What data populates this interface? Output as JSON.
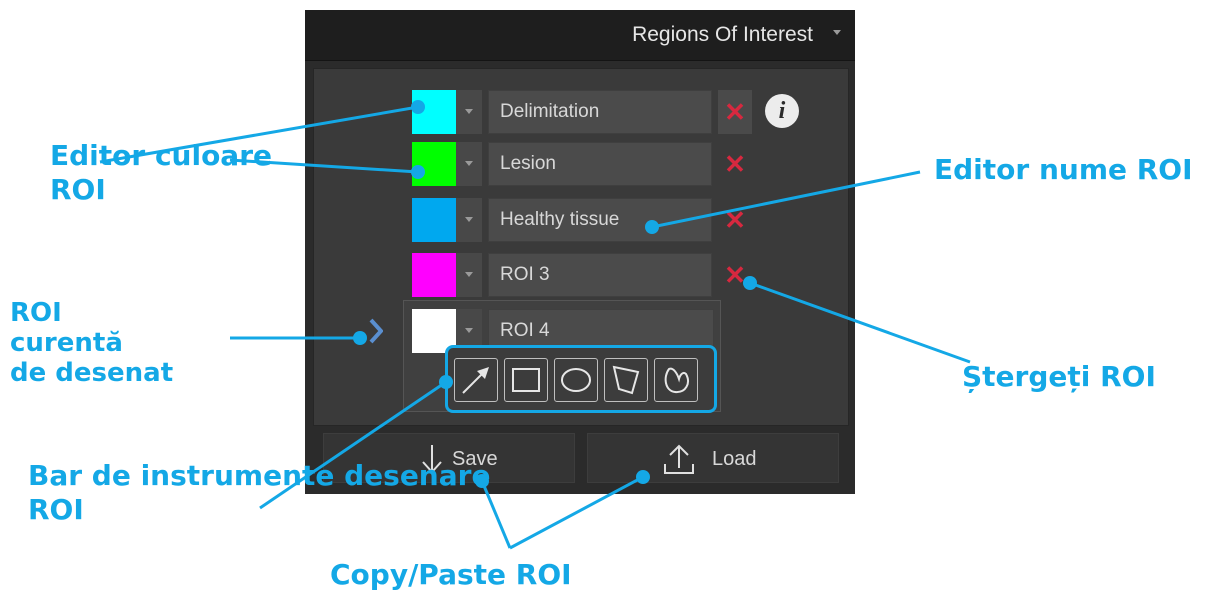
{
  "panel": {
    "title": "Regions Of Interest",
    "rois": [
      {
        "name": "Delimitation",
        "color": "#00ffff"
      },
      {
        "name": "Lesion",
        "color": "#00ff00"
      },
      {
        "name": "Healthy tissue",
        "color": "#00a8ef"
      },
      {
        "name": "ROI 3",
        "color": "#ff00ff"
      },
      {
        "name": "ROI 4",
        "color": "#ffffff"
      }
    ],
    "info_icon_glyph": "i",
    "delete_glyph": "✕",
    "tools": [
      "arrow-tool-icon",
      "rectangle-tool-icon",
      "ellipse-tool-icon",
      "polygon-tool-icon",
      "freehand-tool-icon"
    ],
    "save_label": "Save",
    "load_label": "Load"
  },
  "callouts": {
    "color_editor_line1": "Editor culoare",
    "color_editor_line2": "ROI",
    "name_editor": "Editor nume ROI",
    "current_line1": "ROI",
    "current_line2": "curentă",
    "current_line3": "de desenat",
    "delete_roi": "Ștergeți ROI",
    "toolbar_line1": "Bar de instrumente desenare",
    "toolbar_line2": "ROI",
    "copy_paste": "Copy/Paste ROI"
  },
  "colors": {
    "accent": "#14a8e6",
    "delete": "#d7283f"
  }
}
